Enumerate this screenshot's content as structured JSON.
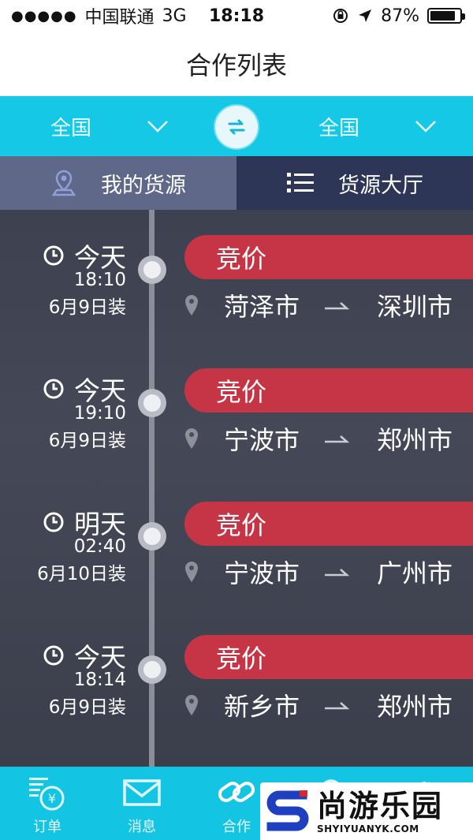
{
  "status_bar": {
    "signal": "●●●●●",
    "carrier": "中国联通",
    "network": "3G",
    "time": "18:18",
    "battery": "87%",
    "battery_level": 0.87
  },
  "title": "合作列表",
  "region": {
    "from_label": "全国",
    "to_label": "全国"
  },
  "tabs": [
    {
      "label": "我的货源",
      "icon": "location-pin-icon"
    },
    {
      "label": "货源大厅",
      "icon": "list-icon"
    }
  ],
  "items": [
    {
      "day": "今天",
      "time": "18:10",
      "load_date": "6月9日装",
      "tag": "竞价",
      "from": "菏泽市",
      "to": "深圳市"
    },
    {
      "day": "今天",
      "time": "19:10",
      "load_date": "6月9日装",
      "tag": "竞价",
      "from": "宁波市",
      "to": "郑州市"
    },
    {
      "day": "明天",
      "time": "02:40",
      "load_date": "6月10日装",
      "tag": "竞价",
      "from": "宁波市",
      "to": "广州市"
    },
    {
      "day": "今天",
      "time": "18:14",
      "load_date": "6月9日装",
      "tag": "竞价",
      "from": "新乡市",
      "to": "郑州市"
    }
  ],
  "bottom_nav": [
    {
      "label": "订单",
      "icon": "order-icon"
    },
    {
      "label": "消息",
      "icon": "mail-icon"
    },
    {
      "label": "合作",
      "icon": "link-icon"
    },
    {
      "label": "",
      "icon": "search-icon"
    },
    {
      "label": "",
      "icon": "gear-icon"
    }
  ],
  "watermark": {
    "cn": "尚游乐园",
    "en": "SHYIYUANYK.COM"
  },
  "colors": {
    "accent": "#14c8e6",
    "tag": "#c63545",
    "tab_active": "#5f6889",
    "tab_inactive": "#2e3657"
  }
}
